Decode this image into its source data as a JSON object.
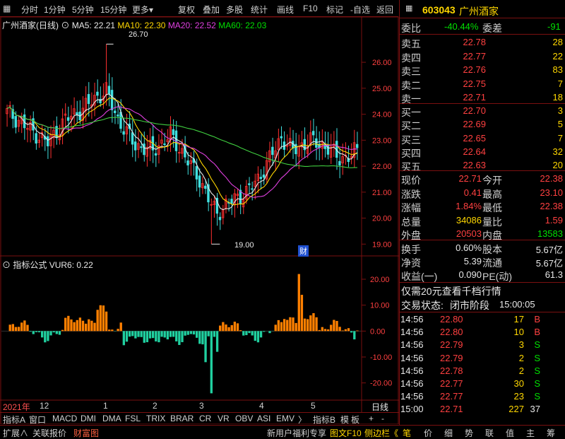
{
  "toolbar": {
    "items": [
      "分时",
      "1分钟",
      "5分钟",
      "15分钟",
      "更多▾",
      "复权",
      "叠加",
      "多股",
      "统计",
      "画线",
      "F10",
      "标记",
      "-自选",
      "返回"
    ]
  },
  "chart_title": {
    "name": "广州酒家(日线)",
    "ma5": "MA5: 22.21",
    "ma10": "MA10: 22.30",
    "ma20": "MA20: 22.52",
    "ma60": "MA60: 22.03",
    "high_mark": "26.70",
    "low_mark": "19.00",
    "cai": "财"
  },
  "colors": {
    "up": "#ff3030",
    "down": "#40e0e0",
    "ma5": "#e8e8e8",
    "ma10": "#ffd700",
    "ma20": "#e040e0",
    "ma60": "#40d040",
    "frame": "#7a1010"
  },
  "indicator": {
    "title": "指标公式",
    "value": "VUR6: 0.22"
  },
  "chart_data": [
    {
      "type": "candlestick",
      "title": "广州酒家(日线)",
      "ylim": [
        18.6,
        27.2
      ],
      "yticks": [
        "26.00",
        "25.00",
        "24.00",
        "23.00",
        "22.00",
        "21.00",
        "20.00",
        "19.00"
      ],
      "series": [
        {
          "name": "MA5",
          "last": 22.21
        },
        {
          "name": "MA10",
          "last": 22.3
        },
        {
          "name": "MA20",
          "last": 22.52
        },
        {
          "name": "MA60",
          "last": 22.03
        }
      ],
      "high": 26.7,
      "low": 19.0,
      "last_close": 22.71
    },
    {
      "type": "bar",
      "title": "VUR6",
      "ylim": [
        -25,
        23
      ],
      "yticks": [
        "20.00",
        "10.00",
        "0.00",
        "-10.00",
        "-20.00"
      ],
      "last": 0.22
    }
  ],
  "dates": [
    "2021年",
    "12",
    "1",
    "2",
    "3",
    "4",
    "5"
  ],
  "symbol": {
    "code": "603043",
    "name": "广州酒家"
  },
  "weibi": {
    "label1": "委比",
    "v1": "-40.44%",
    "label2": "委差",
    "v2": "-91"
  },
  "sells": [
    {
      "label": "卖五",
      "price": "22.78",
      "vol": "28"
    },
    {
      "label": "卖四",
      "price": "22.77",
      "vol": "22"
    },
    {
      "label": "卖三",
      "price": "22.76",
      "vol": "83"
    },
    {
      "label": "卖二",
      "price": "22.75",
      "vol": "7"
    },
    {
      "label": "卖一",
      "price": "22.71",
      "vol": "18"
    }
  ],
  "buys": [
    {
      "label": "买一",
      "price": "22.70",
      "vol": "3"
    },
    {
      "label": "买二",
      "price": "22.69",
      "vol": "5"
    },
    {
      "label": "买三",
      "price": "22.65",
      "vol": "7"
    },
    {
      "label": "买四",
      "price": "22.64",
      "vol": "32"
    },
    {
      "label": "买五",
      "price": "22.63",
      "vol": "20"
    }
  ],
  "quote": [
    {
      "l1": "现价",
      "v1": "22.71",
      "l2": "今开",
      "v2": "22.38"
    },
    {
      "l1": "涨跌",
      "v1": "0.41",
      "l2": "最高",
      "v2": "23.10"
    },
    {
      "l1": "涨幅",
      "v1": "1.84%",
      "l2": "最低",
      "v2": "22.38"
    },
    {
      "l1": "总量",
      "v1": "34086",
      "l2": "量比",
      "v2": "1.59"
    },
    {
      "l1": "外盘",
      "v1": "20503",
      "l2": "内盘",
      "v2": "13583"
    }
  ],
  "fin": [
    {
      "l1": "换手",
      "v1": "0.60%",
      "l2": "股本",
      "v2": "5.67亿"
    },
    {
      "l1": "净资",
      "v1": "5.39",
      "l2": "流通",
      "v2": "5.67亿"
    },
    {
      "l1": "收益(一)",
      "v1": "0.090",
      "l2": "PE(动)",
      "v2": "61.3"
    }
  ],
  "promo": "仅需20元查看千档行情",
  "status": {
    "label": "交易状态:",
    "state": "闭市阶段",
    "time": "15:00:05"
  },
  "trades": [
    {
      "t": "14:56",
      "p": "22.80",
      "v": "17",
      "f": "B"
    },
    {
      "t": "14:56",
      "p": "22.80",
      "v": "10",
      "f": "B"
    },
    {
      "t": "14:56",
      "p": "22.79",
      "v": "3",
      "f": "S"
    },
    {
      "t": "14:56",
      "p": "22.79",
      "v": "2",
      "f": "S"
    },
    {
      "t": "14:56",
      "p": "22.78",
      "v": "2",
      "f": "S"
    },
    {
      "t": "14:56",
      "p": "22.77",
      "v": "30",
      "f": "S"
    },
    {
      "t": "14:56",
      "p": "22.77",
      "v": "23",
      "f": "S"
    },
    {
      "t": "15:00",
      "p": "22.71",
      "v": "227",
      "f": "37"
    }
  ],
  "ind_tabs": [
    "指标A",
    "窗口",
    "MACD",
    "DMI",
    "DMA",
    "FSL",
    "TRIX",
    "BRAR",
    "CR",
    "VR",
    "OBV",
    "ASI",
    "EMV",
    "〉",
    "指标B",
    "模",
    "板",
    "+",
    "-",
    "日线"
  ],
  "bottom_bar": {
    "left": [
      "扩展∧",
      "关联报价",
      "财富图"
    ],
    "mid": [
      "新用户福利专享",
      "图文F10",
      "侧边栏《"
    ],
    "right": [
      "笔",
      "价",
      "细",
      "势",
      "联",
      "值",
      "主",
      "筹"
    ]
  }
}
